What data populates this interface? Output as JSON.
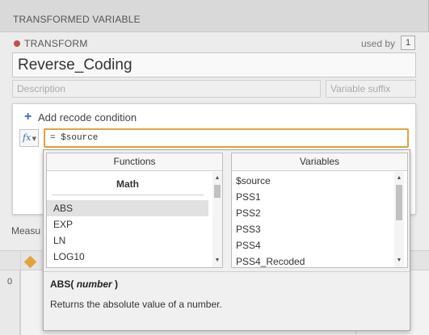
{
  "header": {
    "title": "TRANSFORMED VARIABLE"
  },
  "transform": {
    "label": "TRANSFORM",
    "used_by_label": "used by",
    "used_by_count": "1",
    "name_value": "Reverse_Coding",
    "description_placeholder": "Description",
    "suffix_placeholder": "Variable suffix"
  },
  "recode": {
    "add_label": "Add recode condition",
    "fx_label": "fx",
    "formula_value": "= $source"
  },
  "measure_label": "Measu",
  "sheet": {
    "row_number": "0"
  },
  "popup": {
    "functions_header": "Functions",
    "variables_header": "Variables",
    "category": "Math",
    "functions": [
      "ABS",
      "EXP",
      "LN",
      "LOG10"
    ],
    "selected_function": "ABS",
    "variables": [
      "$source",
      "PSS1",
      "PSS2",
      "PSS3",
      "PSS4",
      "PSS4_Recoded"
    ],
    "signature_name": "ABS(",
    "signature_arg": "number",
    "signature_close": ")",
    "description": "Returns the absolute value of a number."
  },
  "colors": {
    "accent": "#e0a43a",
    "dot": "#c0504d",
    "link": "#3b6bb0"
  }
}
